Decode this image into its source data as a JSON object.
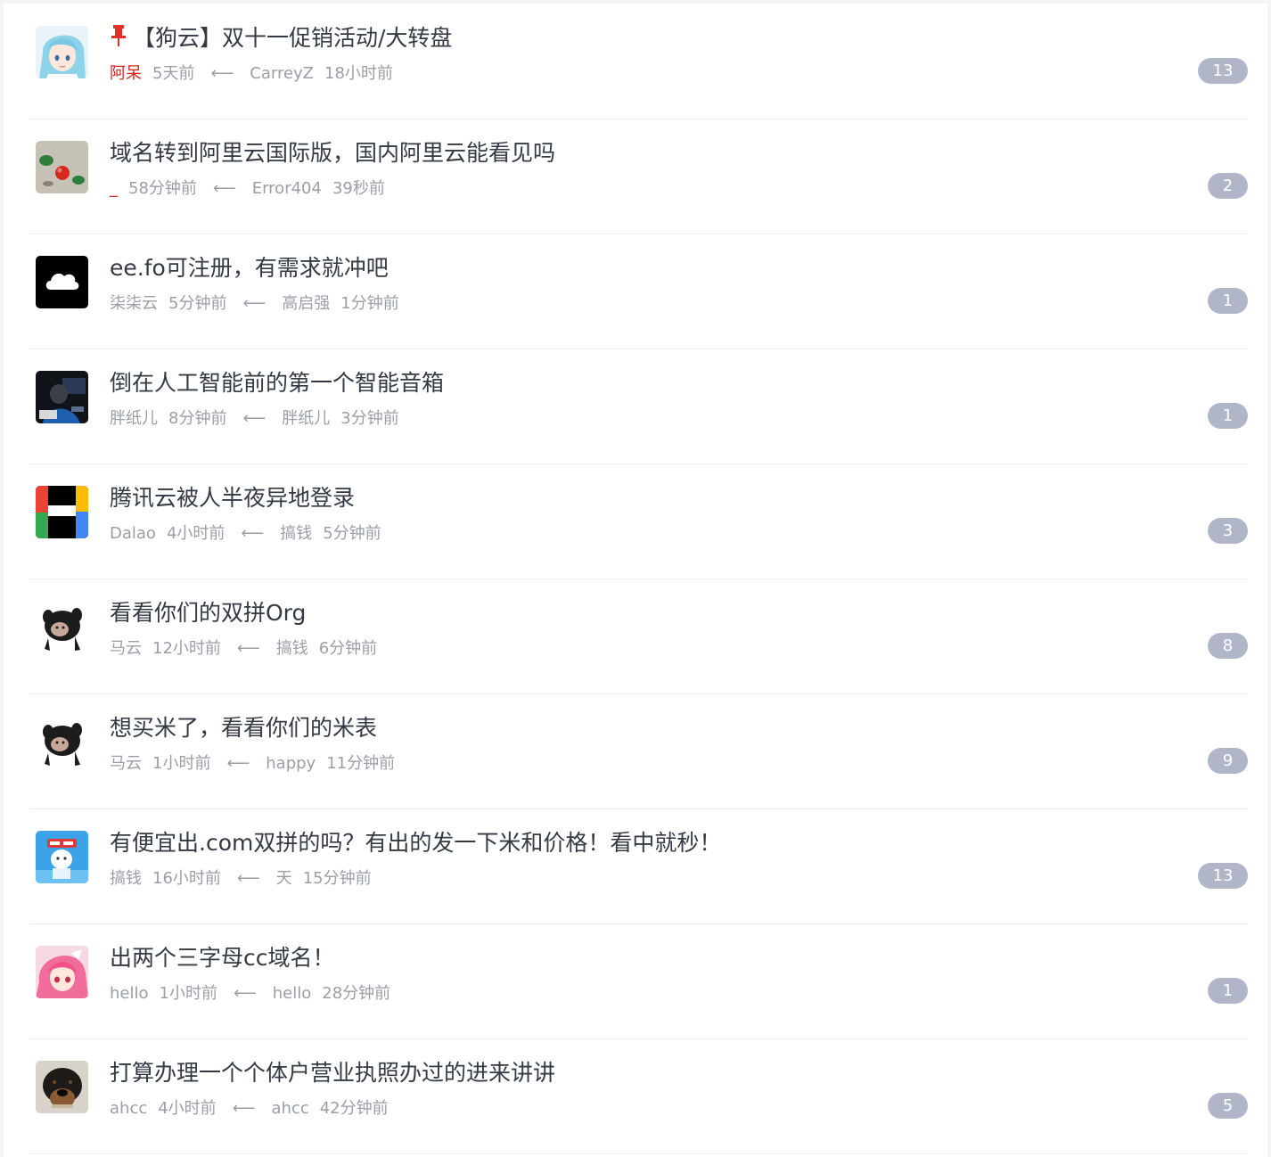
{
  "topics": [
    {
      "title": "【狗云】双十一促销活动/大转盘",
      "author": "阿呆",
      "time": "5天前",
      "arrow": "⟵",
      "last_user": "CarreyZ",
      "last_time": "18小时前",
      "replies": "13"
    },
    {
      "title": "域名转到阿里云国际版，国内阿里云能看见吗",
      "author": "_",
      "time": "58分钟前",
      "arrow": "⟵",
      "last_user": "Error404",
      "last_time": "39秒前",
      "replies": "2"
    },
    {
      "title": "ee.fo可注册，有需求就冲吧",
      "author": "柒柒云",
      "time": "5分钟前",
      "arrow": "⟵",
      "last_user": "高启强",
      "last_time": "1分钟前",
      "replies": "1"
    },
    {
      "title": "倒在人工智能前的第一个智能音箱",
      "author": "胖纸儿",
      "time": "8分钟前",
      "arrow": "⟵",
      "last_user": "胖纸儿",
      "last_time": "3分钟前",
      "replies": "1"
    },
    {
      "title": "腾讯云被人半夜异地登录",
      "author": "Dalao",
      "time": "4小时前",
      "arrow": "⟵",
      "last_user": "搞钱",
      "last_time": "5分钟前",
      "replies": "3"
    },
    {
      "title": "看看你们的双拼Org",
      "author": "马云",
      "time": "12小时前",
      "arrow": "⟵",
      "last_user": "搞钱",
      "last_time": "6分钟前",
      "replies": "8"
    },
    {
      "title": "想买米了，看看你们的米表",
      "author": "马云",
      "time": "1小时前",
      "arrow": "⟵",
      "last_user": "happy",
      "last_time": "11分钟前",
      "replies": "9"
    },
    {
      "title": "有便宜出.com双拼的吗？有出的发一下米和价格！看中就秒！",
      "author": "搞钱",
      "time": "16小时前",
      "arrow": "⟵",
      "last_user": "天",
      "last_time": "15分钟前",
      "replies": "13"
    },
    {
      "title": "出两个三字母cc域名！",
      "author": "hello",
      "time": "1小时前",
      "arrow": "⟵",
      "last_user": "hello",
      "last_time": "28分钟前",
      "replies": "1"
    },
    {
      "title": "打算办理一个个体户营业执照办过的进来讲讲",
      "author": "ahcc",
      "time": "4小时前",
      "arrow": "⟵",
      "last_user": "ahcc",
      "last_time": "42分钟前",
      "replies": "5"
    }
  ],
  "colors": {
    "pinned_author": "#d0231b",
    "pin": "#e0302a",
    "badge_bg": "#b0b6c8",
    "title_text": "#333a44",
    "meta_text": "#9a9ea6"
  },
  "icons": {
    "pin": "pushpin-icon",
    "avatars": [
      "anime-girl-avatar",
      "red-ball-avatar",
      "cloud-logo-avatar",
      "dark-photo-avatar",
      "color-blocks-logo-avatar",
      "dog-meme-avatar",
      "dog-meme-avatar",
      "cartoon-character-avatar",
      "pink-hair-girl-avatar",
      "rottweiler-dog-avatar"
    ]
  }
}
